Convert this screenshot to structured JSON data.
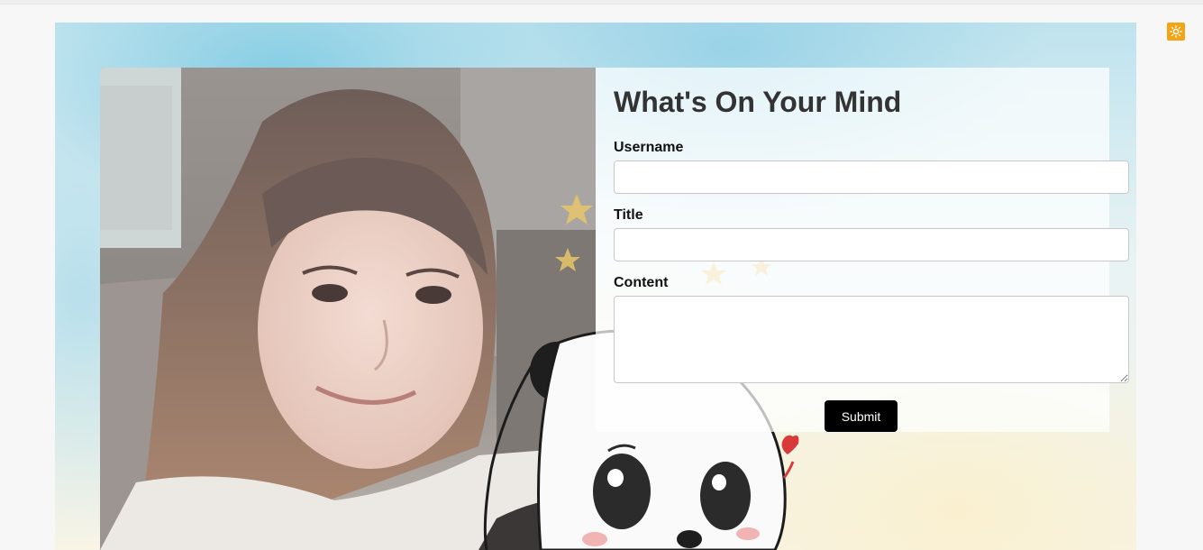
{
  "form": {
    "title": "What's On Your Mind",
    "username_label": "Username",
    "title_label": "Title",
    "content_label": "Content",
    "username_value": "",
    "title_value": "",
    "content_value": "",
    "submit_label": "Submit"
  },
  "icons": {
    "theme_toggle": "sun-icon"
  },
  "colors": {
    "toggle_bg": "#f2a516",
    "submit_bg": "#000000",
    "title_text": "#333333"
  }
}
